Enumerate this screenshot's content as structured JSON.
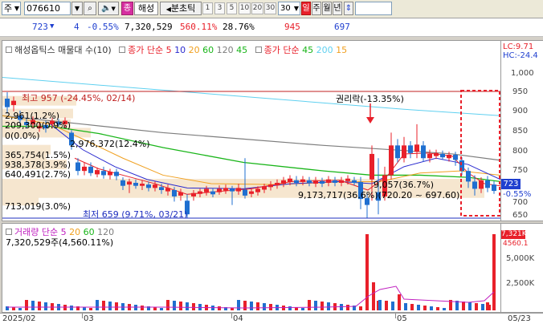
{
  "toolbar": {
    "type_label": "주",
    "code": "076610",
    "code_name_badge": "종",
    "company_name": "해성",
    "period_label": "분초틱",
    "intervals": [
      "1",
      "3",
      "5",
      "10",
      "20",
      "30"
    ],
    "interval_selected": "30",
    "period_day": "일",
    "period_week": "주",
    "period_month": "월",
    "period_year": "년"
  },
  "info": {
    "price": "723",
    "change": "4",
    "change_pct": "-0.55%",
    "volume": "7,320,529",
    "vol_ratio": "560.11%",
    "turnover": "28.76%",
    "val1": "945",
    "val2": "697"
  },
  "price_panel": {
    "legend_title": "해성옵틱스 매물대 수(10)",
    "legend_ma_label": "종가 단순",
    "legend_ma_periods": [
      "5",
      "10",
      "20",
      "60",
      "120",
      "45"
    ],
    "legend_ma2_label": "종가 단순",
    "legend_ma2_periods": [
      "45",
      "200",
      "15"
    ],
    "corner_lc": "LC:9.71",
    "corner_hc": "HC:-24.4",
    "high_annotation": "최고 957 (-24.45%, 02/14)",
    "low_annotation": "최저 659 (9.71%, 03/21)",
    "rights_annotation": "권리락(-13.35%)",
    "range_annotation": "9,173,717(36.6%)(720.20 ~ 697.60)",
    "range_annotation_2": "9,057(36.7%)",
    "profile_labels": [
      "2,976,372(12.4%)",
      "365,754(1.5%)",
      "938,378(3.9%)",
      "640,491(2.7%)",
      "713,019(3.0%)",
      "0(0.0%)",
      "2,961(1.2%)",
      "209,300(0.9%)"
    ],
    "axis_ticks": [
      "1,000",
      "950",
      "900",
      "850",
      "800",
      "750",
      "700",
      "650"
    ],
    "current_price_tag": "723",
    "current_pct_tag": "-0.55%"
  },
  "volume_panel": {
    "legend_label": "거래량 단순",
    "legend_periods": [
      "5",
      "20",
      "60",
      "120"
    ],
    "volume_text": "7,320,529주(4,560.11%)",
    "axis_ticks": [
      "5,000K",
      "2,500K"
    ],
    "current_volume_tag": "7,321K",
    "current_ratio_tag": "4560.1"
  },
  "date_axis": {
    "labels": [
      "2025/02",
      "03",
      "04",
      "05",
      "05/23"
    ]
  },
  "colors": {
    "up": "#e8202a",
    "down": "#1f6fd0",
    "ma5": "#e8202a",
    "ma10": "#2a2acf",
    "ma20": "#f0a020",
    "ma60": "#19b519",
    "ma120": "#7d7d7d",
    "ma200": "#5fd0f0",
    "profile": "#f6e6cf"
  }
}
